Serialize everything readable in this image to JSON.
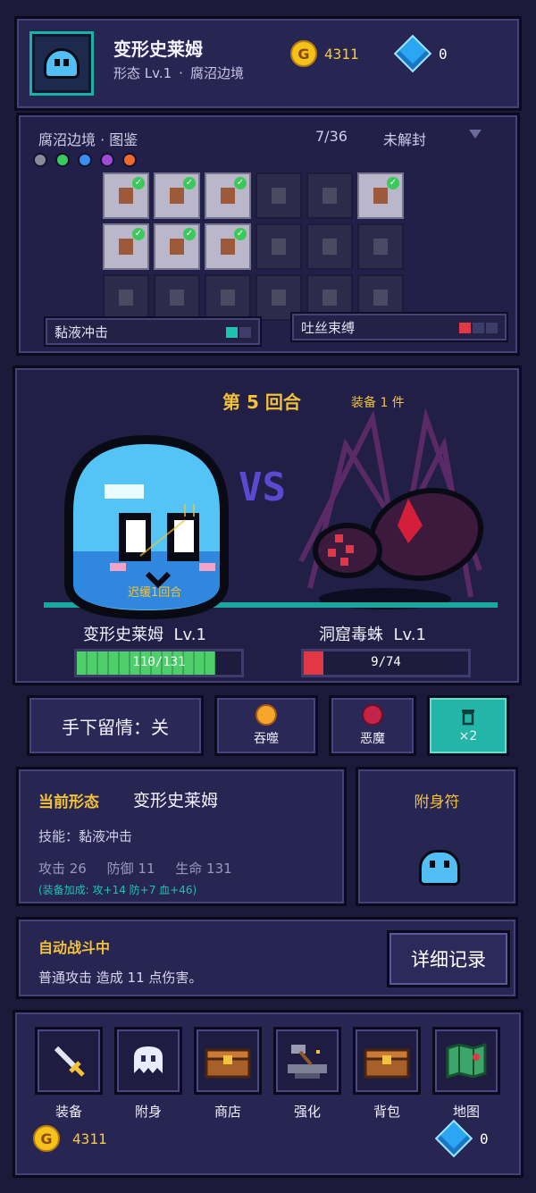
{
  "header": {
    "name": "变形史莱姆",
    "form": "形态 Lv.1",
    "separator": "·",
    "region": "腐沼边境",
    "gold": "4311",
    "gems": "0",
    "gold_symbol": "G"
  },
  "codex": {
    "title": "腐沼边境 · 图鉴",
    "count": "7/36",
    "status": "未解封",
    "filter_colors": [
      "#8a8a9a",
      "#3cc85a",
      "#3a8ef0",
      "#a04ad8",
      "#ef6a2a"
    ],
    "cells": [
      {
        "unlocked": true
      },
      {
        "unlocked": true
      },
      {
        "unlocked": true
      },
      {
        "unlocked": false
      },
      {
        "unlocked": false
      },
      {
        "unlocked": true
      },
      {
        "unlocked": true
      },
      {
        "unlocked": true
      },
      {
        "unlocked": true
      },
      {
        "unlocked": false
      },
      {
        "unlocked": false
      },
      {
        "unlocked": false
      },
      {
        "unlocked": false
      },
      {
        "unlocked": false
      },
      {
        "unlocked": false
      },
      {
        "unlocked": false
      },
      {
        "unlocked": false
      },
      {
        "unlocked": false
      }
    ],
    "check_mark": "✓",
    "skill_left": "黏液冲击",
    "skill_right": "吐丝束缚"
  },
  "battle": {
    "round": "第 5 回合",
    "equip": "装备 1 件",
    "vs": "VS",
    "delay": "迟缓1回合",
    "player": {
      "name": "变形史莱姆",
      "level": "Lv.1",
      "hp_text": "110/131",
      "hp_fraction": 0.84
    },
    "enemy": {
      "name": "洞窟毒蛛",
      "level": "Lv.1",
      "hp_text": "9/74",
      "hp_fraction": 0.12
    }
  },
  "actions": {
    "mercy": "手下留情：关",
    "devour": "吞噬",
    "demon": "恶魔",
    "trash_count": "×2"
  },
  "form_panel": {
    "current_label": "当前形态",
    "name": "变形史莱姆",
    "skill": "技能：黏液冲击",
    "attack": "攻击 26",
    "defense": "防御 11",
    "life": "生命 131",
    "bonus": "(装备加成: 攻+14 防+7 血+46)"
  },
  "possess_panel": {
    "title": "附身符"
  },
  "auto": {
    "title": "自动战斗中",
    "message": "普通攻击 造成 11 点伤害。",
    "detail_button": "详细记录"
  },
  "nav": {
    "items": [
      {
        "label": "装备",
        "icon": "sword-icon"
      },
      {
        "label": "附身",
        "icon": "ghost-icon"
      },
      {
        "label": "商店",
        "icon": "shop-chest-icon"
      },
      {
        "label": "强化",
        "icon": "anvil-hammer-icon"
      },
      {
        "label": "背包",
        "icon": "backpack-chest-icon"
      },
      {
        "label": "地图",
        "icon": "map-icon"
      }
    ],
    "gold": "4311",
    "gems": "0"
  }
}
